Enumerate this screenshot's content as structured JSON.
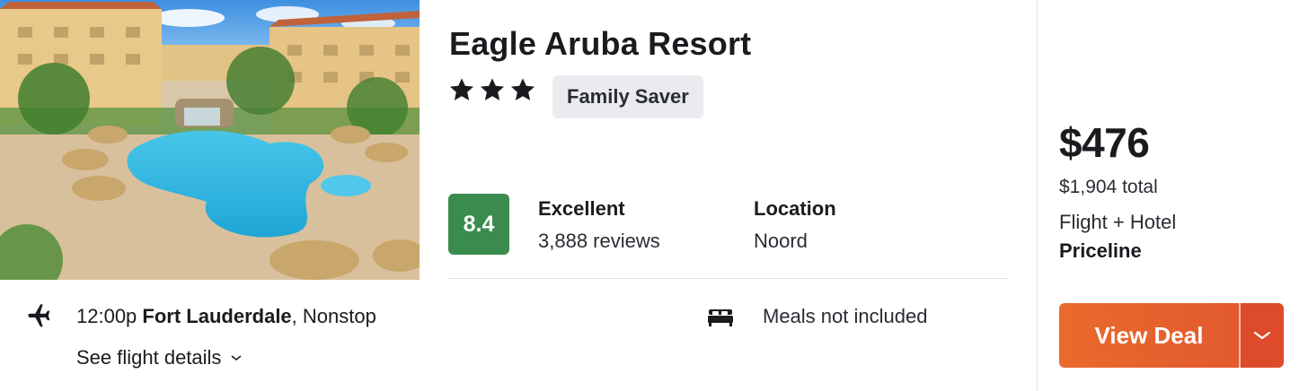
{
  "hotel": {
    "name": "Eagle Aruba Resort",
    "stars": 3,
    "badge": "Family Saver",
    "score": "8.4",
    "rating_label": "Excellent",
    "reviews": "3,888 reviews",
    "location_label": "Location",
    "location": "Noord"
  },
  "flight": {
    "time": "12:00p",
    "origin": "Fort Lauderdale",
    "stops": ", Nonstop",
    "details_link": "See flight details"
  },
  "meals": "Meals not included",
  "pricing": {
    "price": "$476",
    "total": "$1,904 total",
    "package": "Flight + Hotel",
    "provider": "Priceline"
  },
  "cta": {
    "label": "View Deal"
  },
  "colors": {
    "score_bg": "#3b8a4e",
    "cta_orange": "#ea6a2c",
    "cta_dark": "#dd4b2a",
    "badge_bg": "#e9ebef"
  },
  "icons": [
    "star-icon",
    "airplane-icon",
    "chevron-down-icon",
    "bed-icon"
  ]
}
